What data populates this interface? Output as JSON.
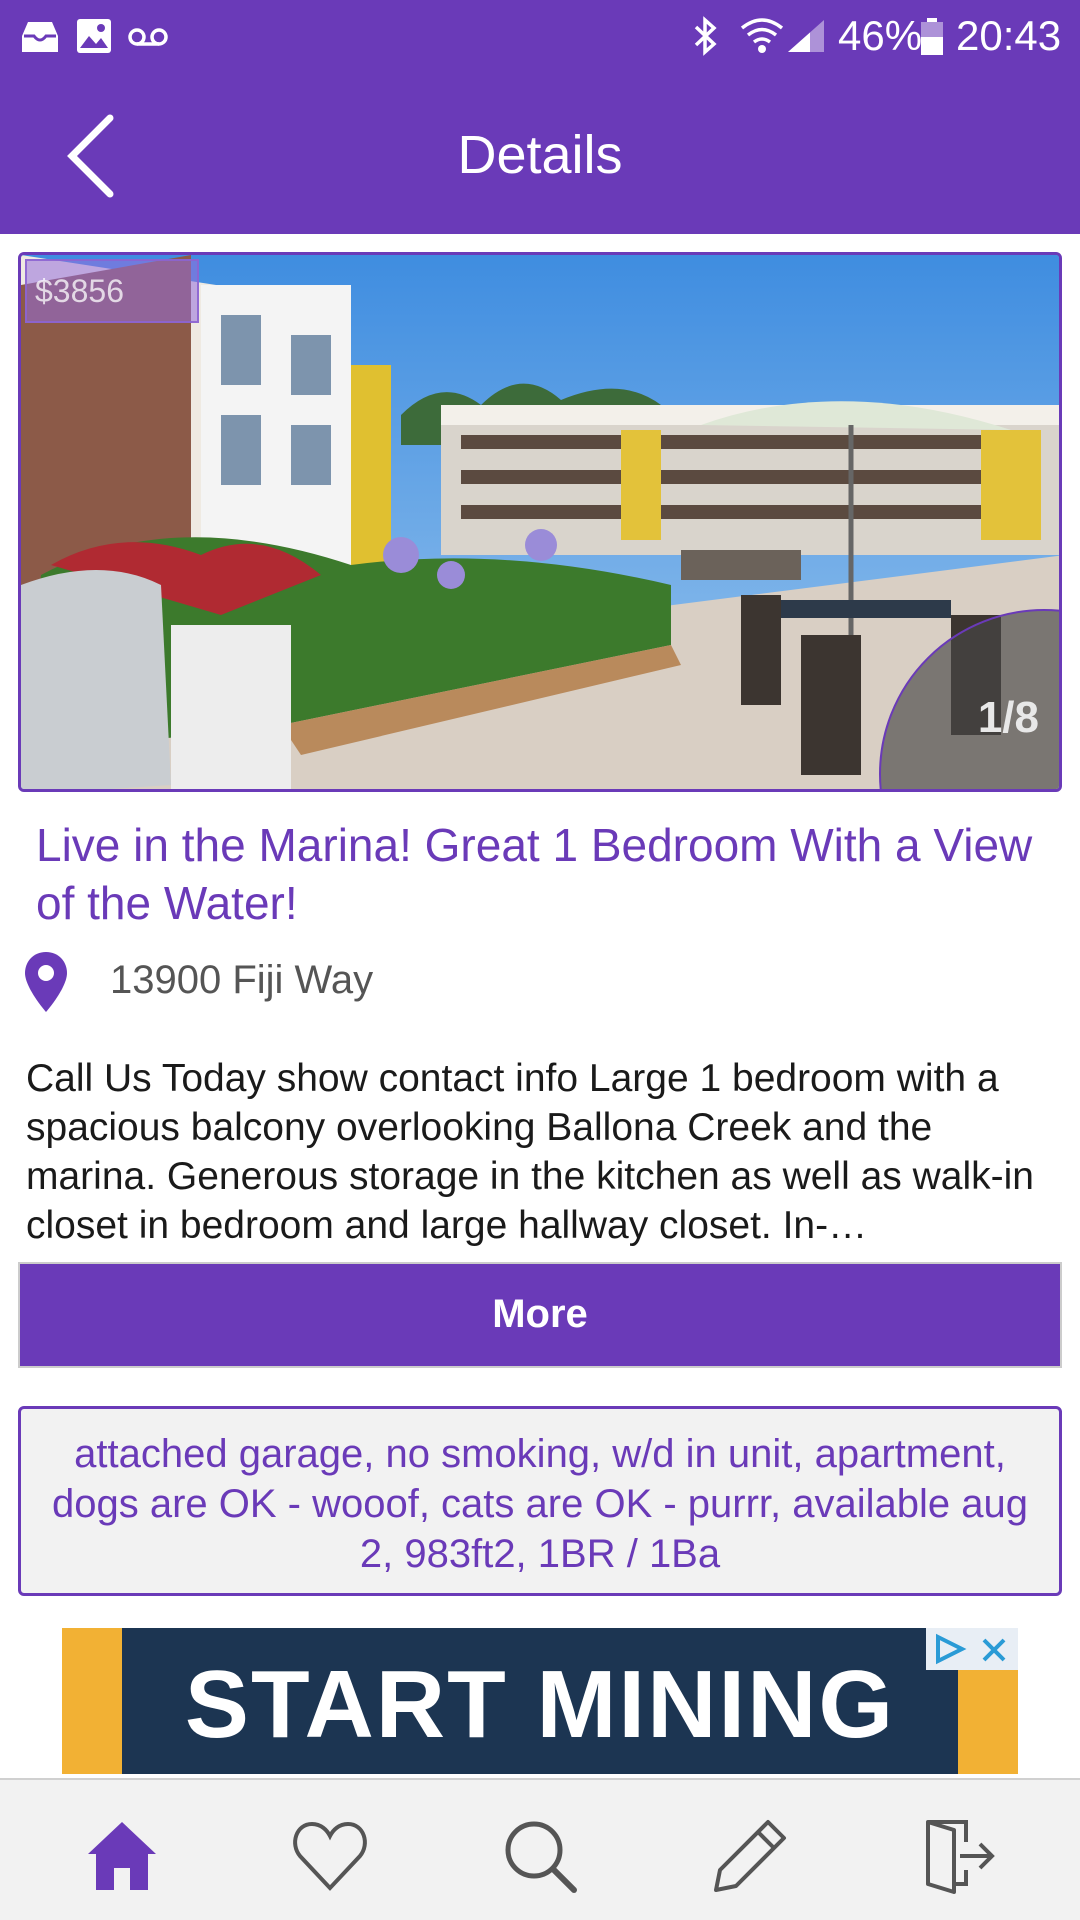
{
  "status_bar": {
    "battery": "46%",
    "time": "20:43",
    "icons": [
      "inbox-icon",
      "image-icon",
      "voicemail-icon",
      "bluetooth-icon",
      "wifi-icon",
      "signal-icon",
      "battery-icon"
    ]
  },
  "app_bar": {
    "title": "Details",
    "back_icon": "back-arrow-icon"
  },
  "gallery": {
    "price": "$3856",
    "counter": "1/8"
  },
  "listing": {
    "title": "Live in the Marina! Great 1 Bedroom With a View of the Water!",
    "address": "13900 Fiji Way",
    "description": "Call Us Today show contact info Large 1 bedroom with a spacious balcony overlooking Ballona Creek and the marina. Generous storage in the kitchen as well as walk-in closet in bedroom and large hallway closet. In-…",
    "more_label": "More",
    "attributes": "attached garage, no smoking, w/d in unit, apartment, dogs are OK - wooof, cats are OK - purrr, available aug 2, 983ft2, 1BR / 1Ba"
  },
  "ad": {
    "text": "START MINING"
  },
  "bottom_nav": {
    "items": [
      "home-icon",
      "heart-icon",
      "search-icon",
      "pencil-icon",
      "logout-icon"
    ],
    "active": "home-icon"
  },
  "colors": {
    "primary": "#6a3ab8",
    "nav_inactive": "#555555"
  }
}
